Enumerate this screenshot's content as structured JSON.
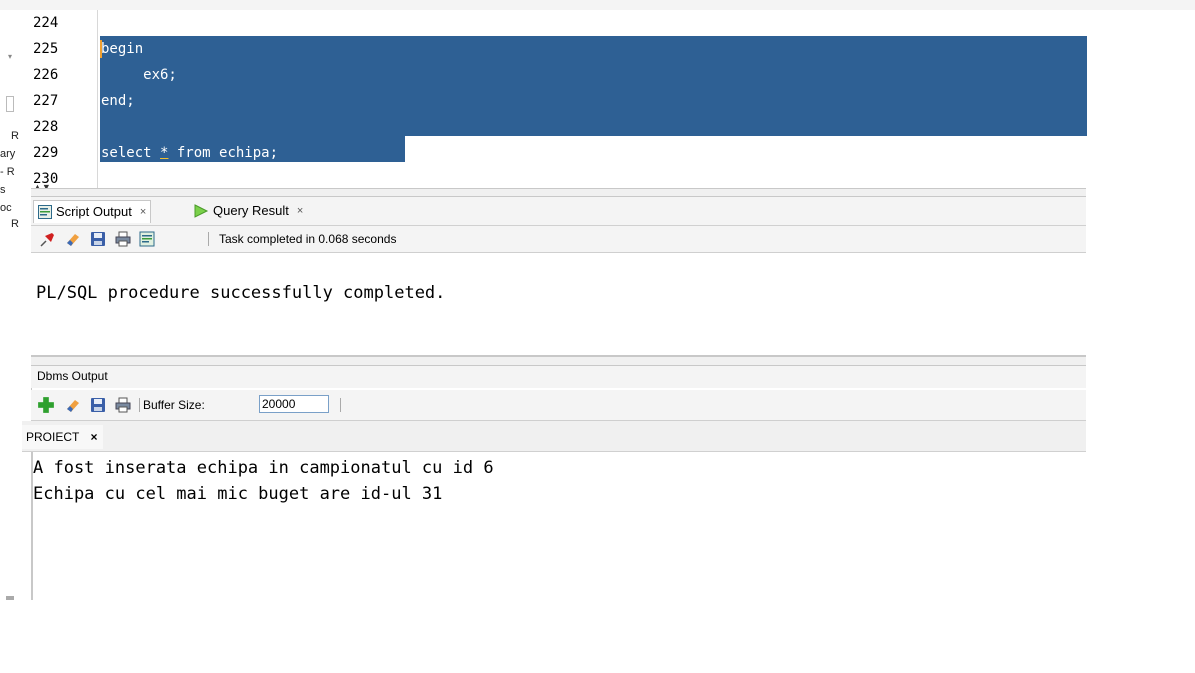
{
  "left_panel": {
    "fragments": [
      "R",
      "ary",
      "- R",
      "s",
      "oc",
      "R"
    ]
  },
  "editor": {
    "line_numbers": [
      "224",
      "225",
      "226",
      "227",
      "228",
      "229",
      "230"
    ],
    "lines": [
      "",
      "begin",
      "     ex6;",
      "end;",
      "",
      "select * from echipa;",
      ""
    ],
    "line_229_parts": {
      "a": "select ",
      "star": "*",
      "b": " from echipa;"
    },
    "selection_color": "#2e6094"
  },
  "output_tabs": [
    {
      "label": "Script Output",
      "close": "×",
      "icon": "script-output-icon"
    },
    {
      "label": "Query Result",
      "close": "×",
      "icon": "run-triangle-icon"
    }
  ],
  "script_toolbar": {
    "status": "Task completed in 0.068 seconds",
    "icons": [
      "pin-icon",
      "eraser-icon",
      "save-icon",
      "print-icon",
      "open-file-icon"
    ]
  },
  "script_output": {
    "text": "PL/SQL procedure successfully completed."
  },
  "dbms": {
    "title": "Dbms Output",
    "buffer_label": "Buffer Size:",
    "buffer_value": "20000",
    "icons": [
      "add-icon",
      "eraser-icon",
      "save-icon",
      "print-icon"
    ],
    "connection_tab": "PROIECT",
    "connection_close": "×",
    "lines": [
      "A fost inserata echipa in campionatul cu id 6",
      "Echipa cu cel mai mic buget are id-ul 31"
    ]
  }
}
